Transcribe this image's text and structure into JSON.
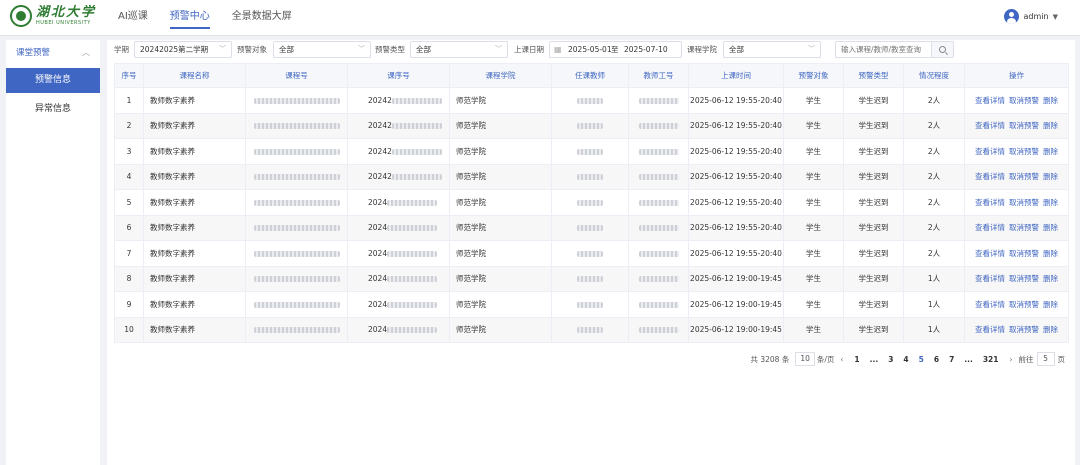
{
  "header": {
    "logo_cn": "湖北大学",
    "logo_en": "HUBEI UNIVERSITY",
    "tabs": [
      {
        "label": "AI巡课"
      },
      {
        "label": "预警中心"
      },
      {
        "label": "全景数据大屏"
      }
    ],
    "active_tab": "预警中心",
    "user_name": "admin"
  },
  "sidebar": {
    "group_label": "课堂预警",
    "items": [
      {
        "label": "预警信息"
      },
      {
        "label": "异常信息"
      }
    ]
  },
  "filters": {
    "term_label": "学期",
    "term_value": "20242025第二学期",
    "target_label": "预警对象",
    "target_value": "全部",
    "type_label": "预警类型",
    "type_value": "全部",
    "date_label": "上课日期",
    "date_start": "2025-05-01",
    "date_sep": "至",
    "date_end": "2025-07-10",
    "college_label": "课程学院",
    "college_value": "全部",
    "search_placeholder": "输入课程/教师/教室查询"
  },
  "table": {
    "headers": [
      "序号",
      "课程名称",
      "课程号",
      "课序号",
      "课程学院",
      "任课教师",
      "教师工号",
      "上课时间",
      "预警对象",
      "预警类型",
      "情况程度",
      "操作"
    ],
    "rows": [
      {
        "no": "1",
        "name": "教师数字素养",
        "seq": "20242",
        "college": "师范学院",
        "time": "2025-06-12 19:55-20:40",
        "target": "学生",
        "type": "学生迟到",
        "degree": "2人"
      },
      {
        "no": "2",
        "name": "教师数字素养",
        "seq": "20242",
        "college": "师范学院",
        "time": "2025-06-12 19:55-20:40",
        "target": "学生",
        "type": "学生迟到",
        "degree": "2人"
      },
      {
        "no": "3",
        "name": "教师数字素养",
        "seq": "20242",
        "college": "师范学院",
        "time": "2025-06-12 19:55-20:40",
        "target": "学生",
        "type": "学生迟到",
        "degree": "2人"
      },
      {
        "no": "4",
        "name": "教师数字素养",
        "seq": "20242",
        "college": "师范学院",
        "time": "2025-06-12 19:55-20:40",
        "target": "学生",
        "type": "学生迟到",
        "degree": "2人"
      },
      {
        "no": "5",
        "name": "教师数字素养",
        "seq": "2024",
        "college": "师范学院",
        "time": "2025-06-12 19:55-20:40",
        "target": "学生",
        "type": "学生迟到",
        "degree": "2人"
      },
      {
        "no": "6",
        "name": "教师数字素养",
        "seq": "2024",
        "college": "师范学院",
        "time": "2025-06-12 19:55-20:40",
        "target": "学生",
        "type": "学生迟到",
        "degree": "2人"
      },
      {
        "no": "7",
        "name": "教师数字素养",
        "seq": "2024",
        "college": "师范学院",
        "time": "2025-06-12 19:55-20:40",
        "target": "学生",
        "type": "学生迟到",
        "degree": "2人"
      },
      {
        "no": "8",
        "name": "教师数字素养",
        "seq": "2024",
        "college": "师范学院",
        "time": "2025-06-12 19:00-19:45",
        "target": "学生",
        "type": "学生迟到",
        "degree": "1人"
      },
      {
        "no": "9",
        "name": "教师数字素养",
        "seq": "2024",
        "college": "师范学院",
        "time": "2025-06-12 19:00-19:45",
        "target": "学生",
        "type": "学生迟到",
        "degree": "1人"
      },
      {
        "no": "10",
        "name": "教师数字素养",
        "seq": "2024",
        "college": "师范学院",
        "time": "2025-06-12 19:00-19:45",
        "target": "学生",
        "type": "学生迟到",
        "degree": "1人"
      }
    ],
    "actions": [
      "查看详情",
      "取消预警",
      "删除"
    ]
  },
  "pagination": {
    "total": "共 3208 条",
    "page_size": "10",
    "per_page_label": "条/页",
    "pages": [
      "1",
      "...",
      "3",
      "4",
      "5",
      "6",
      "7",
      "...",
      "321"
    ],
    "active_page": "5",
    "goto_label": "前往",
    "goto_value": "5",
    "page_unit": "页"
  },
  "colors": {
    "accent": "#3f66c2",
    "logo_green": "#2e7d32"
  }
}
